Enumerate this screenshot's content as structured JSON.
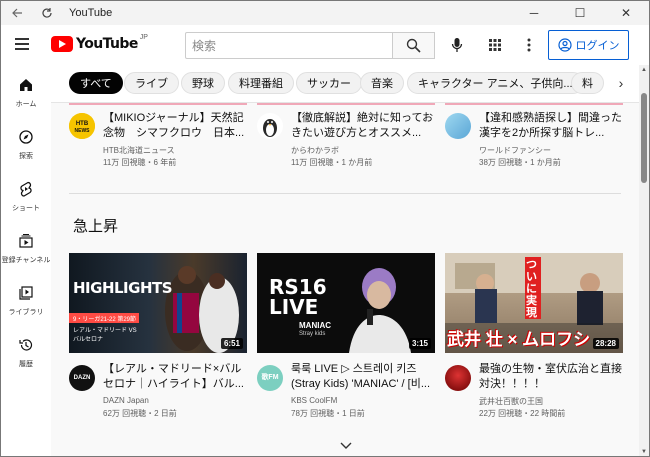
{
  "window": {
    "title": "YouTube",
    "controls": [
      "─",
      "☐",
      "✕"
    ]
  },
  "header": {
    "logo_text": "YouTube",
    "logo_region": "JP",
    "search_placeholder": "検索",
    "login_label": "ログイン"
  },
  "sidebar": {
    "items": [
      {
        "label": "ホーム",
        "icon": "home-icon"
      },
      {
        "label": "探索",
        "icon": "compass-icon"
      },
      {
        "label": "ショート",
        "icon": "shorts-icon"
      },
      {
        "label": "登録チャンネル",
        "icon": "subscriptions-icon"
      },
      {
        "label": "ライブラリ",
        "icon": "library-icon"
      },
      {
        "label": "履歴",
        "icon": "history-icon"
      }
    ]
  },
  "chips": [
    {
      "label": "すべて",
      "active": true
    },
    {
      "label": "ライブ",
      "active": false
    },
    {
      "label": "野球",
      "active": false
    },
    {
      "label": "料理番組",
      "active": false
    },
    {
      "label": "サッカー",
      "active": false
    },
    {
      "label": "音楽",
      "active": false
    },
    {
      "label": "キャラクター アニメ、子供向...",
      "active": false
    },
    {
      "label": "料",
      "active": false
    }
  ],
  "top_row": [
    {
      "title": "【MIKIOジャーナル】天然記念物　シマフクロウ　日本...",
      "channel": "HTB北海道ニュース",
      "meta": "11万 回視聴・6 年前",
      "avatar_color": "#f6c400"
    },
    {
      "title": "【徹底解説】絶対に知っておきたい遊び方とオススメ...",
      "channel": "からわかラボ",
      "meta": "11万 回視聴・1 か月前",
      "avatar_color": "#ffffff"
    },
    {
      "title": "【違和感熟語探し】間違った漢字を2か所探す脳トレ...",
      "channel": "ワールドファンシー",
      "meta": "38万 回視聴・1 か月前",
      "avatar_color": "#7ec8e3"
    }
  ],
  "section": {
    "title": "急上昇"
  },
  "trending": [
    {
      "title": "【レアル・マドリード×バルセロナ｜ハイライト】バル...",
      "channel": "DAZN Japan",
      "meta": "62万 回視聴・2 日前",
      "duration": "6:51",
      "thumb_text": {
        "headline": "HIGHLIGHTS",
        "sub": "9・リーガ21-22 第29節",
        "match": "レアル・マドリード VS バルセロナ"
      },
      "avatar_text": "DAZN"
    },
    {
      "title": "룩룩 LIVE ▷ 스트레이 키즈 (Stray Kids) 'MANIAC' / [비...",
      "channel": "KBS CoolFM",
      "meta": "78万 回視聴・1 日前",
      "duration": "3:15",
      "thumb_text": {
        "l1": "RS16",
        "l2": "LIVE",
        "l3": "MANIAC",
        "l4": "Stray kids"
      },
      "avatar_text": "歌FM"
    },
    {
      "title": "最強の生物・室伏広治と直接対決！！！！",
      "channel": "武井壮百獣の王国",
      "meta": "22万 回視聴・22 時間前",
      "duration": "28:28",
      "thumb_text": {
        "vertical": "ついに実現",
        "names": "武井 壮 × ムロフシ"
      },
      "avatar_text": ""
    }
  ],
  "colors": {
    "accent_red": "#ff0000",
    "login_blue": "#065fd4"
  }
}
